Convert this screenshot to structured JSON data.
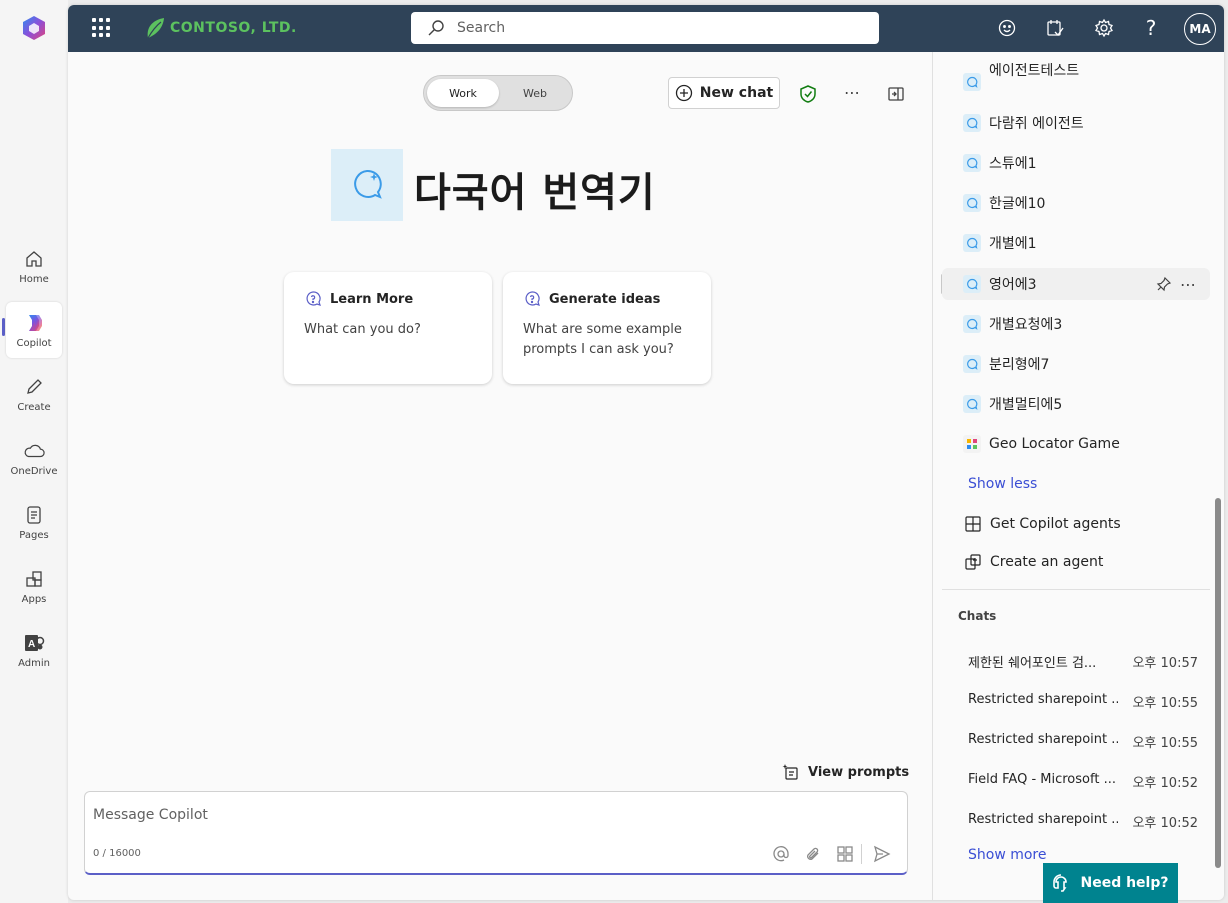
{
  "rail": {
    "items": [
      {
        "label": "Home",
        "icon": "home-icon"
      },
      {
        "label": "Copilot",
        "icon": "copilot-icon"
      },
      {
        "label": "Create",
        "icon": "pencil-icon"
      },
      {
        "label": "OneDrive",
        "icon": "cloud-icon"
      },
      {
        "label": "Pages",
        "icon": "pages-icon"
      },
      {
        "label": "Apps",
        "icon": "apps-icon"
      },
      {
        "label": "Admin",
        "icon": "admin-icon"
      }
    ]
  },
  "topbar": {
    "brand": "CONTOSO, LTD.",
    "search_placeholder": "Search",
    "avatar_initials": "MA",
    "color": "#2f4358"
  },
  "header": {
    "toggle_work": "Work",
    "toggle_web": "Web",
    "new_chat": "New chat"
  },
  "main": {
    "agent_title": "다국어 번역기",
    "cards": [
      {
        "title": "Learn More",
        "body": "What can you do?"
      },
      {
        "title": "Generate ideas",
        "body": "What are some example prompts I can ask you?"
      }
    ],
    "view_prompts": "View prompts",
    "message_placeholder": "Message Copilot",
    "char_count": "0 / 16000"
  },
  "panel": {
    "agents": [
      {
        "label": "에이전트테스트"
      },
      {
        "label": "다람쥐 에이전트"
      },
      {
        "label": "스튜에1"
      },
      {
        "label": "한글에10"
      },
      {
        "label": "개별에1"
      },
      {
        "label": "영어에3"
      },
      {
        "label": "개별요청에3"
      },
      {
        "label": "분리형에7"
      },
      {
        "label": "개별멀티에5"
      },
      {
        "label": "Geo Locator Game"
      }
    ],
    "show_less": "Show less",
    "get_agents": "Get Copilot agents",
    "create_agent": "Create an agent",
    "chats_heading": "Chats",
    "chats": [
      {
        "title": "제한된 쉐어포인트 검...",
        "time": "오후 10:57"
      },
      {
        "title": "Restricted sharepoint ...",
        "time": "오후 10:55"
      },
      {
        "title": "Restricted sharepoint ...",
        "time": "오후 10:55"
      },
      {
        "title": "Field FAQ - Microsoft ...",
        "time": "오후 10:52"
      },
      {
        "title": "Restricted sharepoint ...",
        "time": "오후 10:52"
      }
    ],
    "show_more": "Show more"
  },
  "need_help": "Need help?",
  "colors": {
    "accent": "#5b5fc7",
    "link": "#3a4ed4",
    "help": "#00838f"
  }
}
